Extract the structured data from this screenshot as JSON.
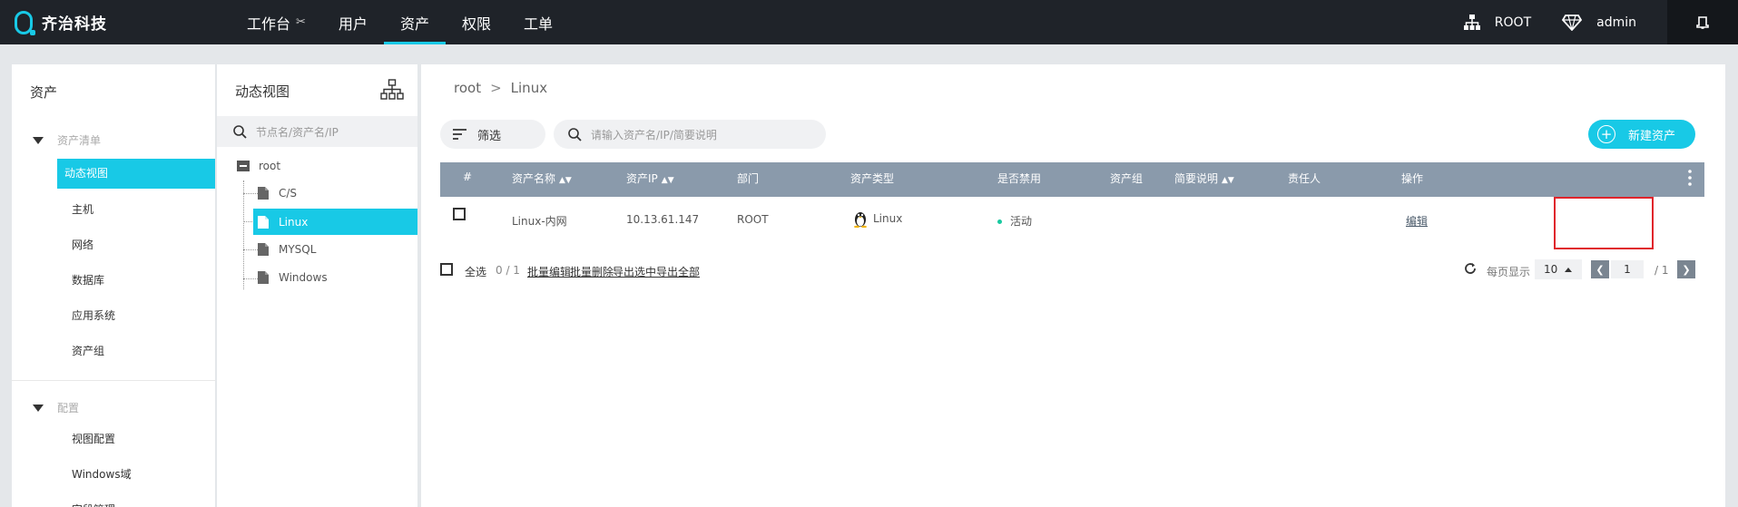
{
  "brand": {
    "name": "齐治科技",
    "accent": "#18c9e6"
  },
  "nav": {
    "items": [
      {
        "label": "工作台",
        "icon": "tools-icon"
      },
      {
        "label": "用户"
      },
      {
        "label": "资产",
        "active": true
      },
      {
        "label": "权限"
      },
      {
        "label": "工单"
      }
    ]
  },
  "topright": {
    "org": "ROOT",
    "user": "admin"
  },
  "sidebar": {
    "title": "资产",
    "groups": [
      {
        "label": "资产清单",
        "items": [
          "动态视图",
          "主机",
          "网络",
          "数据库",
          "应用系统",
          "资产组"
        ]
      },
      {
        "label": "配置",
        "items": [
          "视图配置",
          "Windows域",
          "字段管理"
        ]
      }
    ],
    "active_item": "动态视图"
  },
  "tree": {
    "title": "动态视图",
    "search_placeholder": "节点名/资产名/IP",
    "root": "root",
    "children": [
      "C/S",
      "Linux",
      "MYSQL",
      "Windows"
    ],
    "selected": "Linux"
  },
  "main": {
    "breadcrumb": {
      "root": "root",
      "sep": ">",
      "current": "Linux"
    },
    "filter_label": "筛选",
    "search_placeholder": "请输入资产名/IP/简要说明",
    "new_button": "新建资产",
    "table": {
      "headers": [
        "#",
        "资产名称",
        "资产IP",
        "部门",
        "资产类型",
        "是否禁用",
        "资产组",
        "简要说明",
        "责任人",
        "操作"
      ],
      "rows": [
        {
          "name": "Linux-内网",
          "ip": "10.13.61.147",
          "dept": "ROOT",
          "type": "Linux",
          "status": "活动",
          "group": "",
          "desc": "",
          "owner": "",
          "action": "编辑"
        }
      ]
    },
    "footer": {
      "select_all": "全选",
      "count": "0 / 1",
      "actions": [
        "批量编辑",
        "批量删除",
        "导出选中",
        "导出全部"
      ],
      "per_page_label": "每页显示",
      "per_page": "10",
      "page": "1",
      "total_pages": "/ 1"
    }
  }
}
